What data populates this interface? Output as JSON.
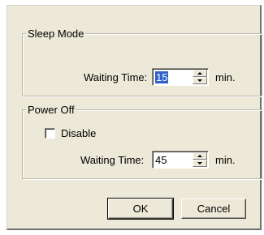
{
  "sleep_mode": {
    "title": "Sleep Mode",
    "waiting_time_label": "Waiting Time:",
    "waiting_time_value": "15",
    "unit": "min."
  },
  "power_off": {
    "title": "Power Off",
    "disable_label": "Disable",
    "disable_checked": false,
    "waiting_time_label": "Waiting Time:",
    "waiting_time_value": "45",
    "unit": "min."
  },
  "buttons": {
    "ok_label": "OK",
    "cancel_label": "Cancel"
  },
  "colors": {
    "dialog_background": "#ece9d8",
    "selection_highlight": "#2f63c9"
  }
}
